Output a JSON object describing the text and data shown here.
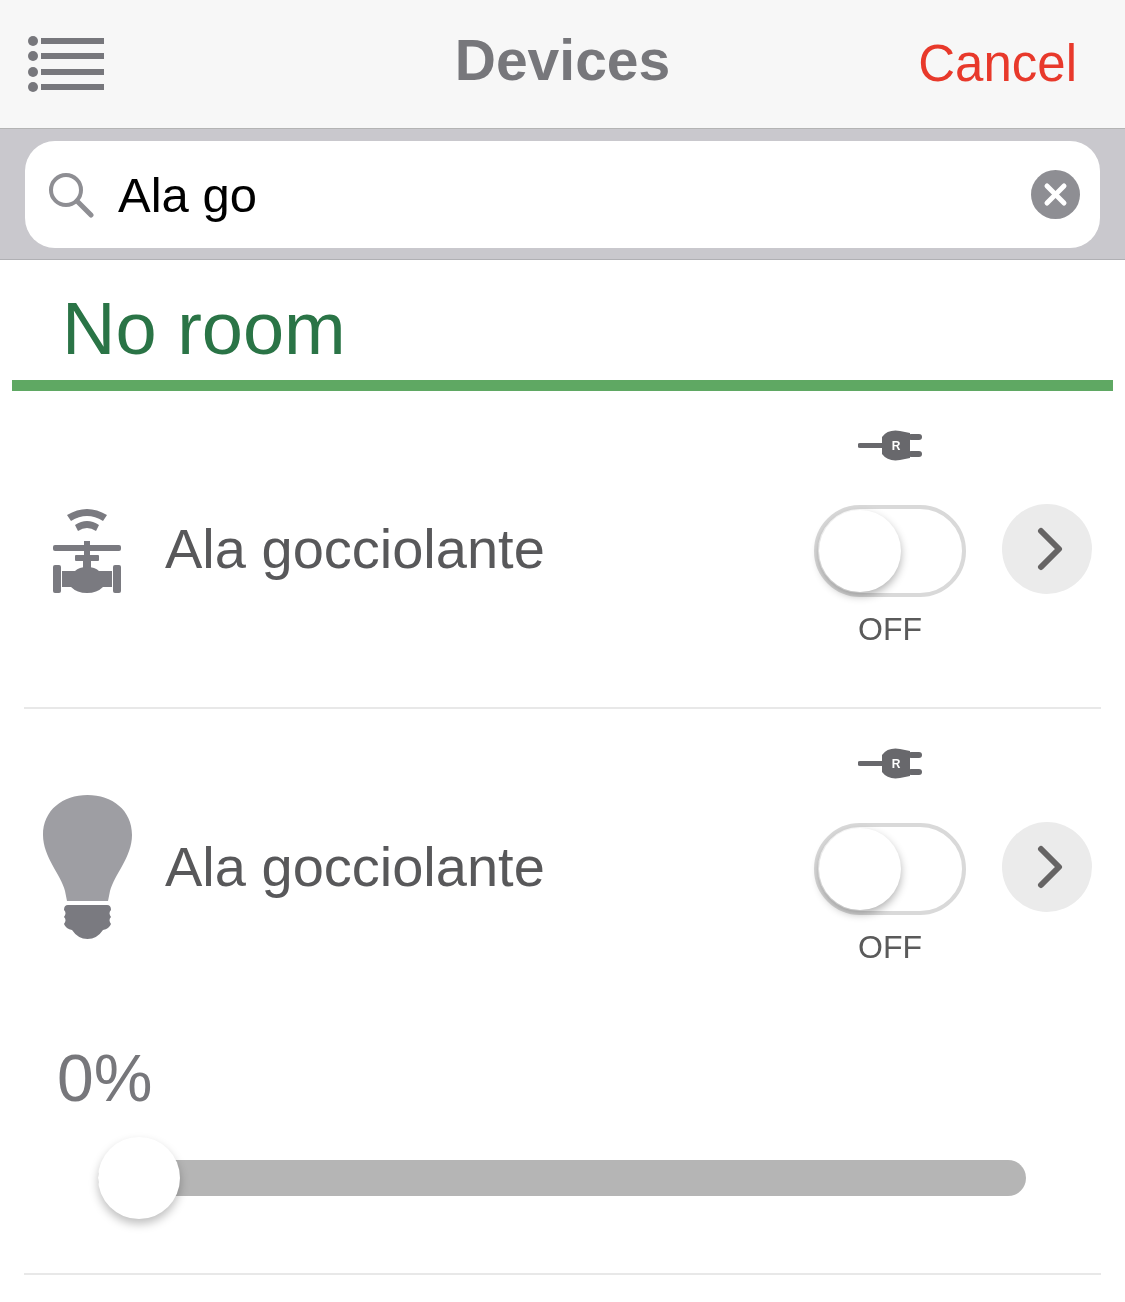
{
  "header": {
    "title": "Devices",
    "cancel": "Cancel"
  },
  "search": {
    "value": "Ala go"
  },
  "sections": [
    {
      "title": "No room",
      "devices": [
        {
          "kind": "valve",
          "name": "Ala gocciolante",
          "plug_label": "R",
          "on": false,
          "state_label": "OFF"
        },
        {
          "kind": "bulb",
          "name": "Ala gocciolante",
          "plug_label": "R",
          "on": false,
          "state_label": "OFF",
          "dimmer": {
            "reading": "0%",
            "level": 0
          }
        }
      ]
    }
  ]
}
